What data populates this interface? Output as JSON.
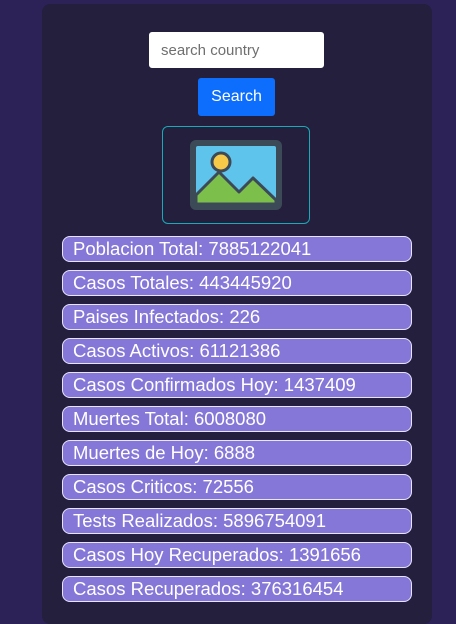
{
  "search": {
    "placeholder": "search country",
    "value": "",
    "button_label": "Search"
  },
  "flag": {
    "icon": "image-placeholder-icon"
  },
  "stats": [
    {
      "label": "Poblacion Total: ",
      "value": "7885122041"
    },
    {
      "label": "Casos Totales: ",
      "value": "443445920"
    },
    {
      "label": "Paises Infectados: ",
      "value": "226"
    },
    {
      "label": "Casos Activos: ",
      "value": "61121386"
    },
    {
      "label": "Casos Confirmados Hoy: ",
      "value": "1437409"
    },
    {
      "label": "Muertes Total: ",
      "value": "6008080"
    },
    {
      "label": "Muertes de Hoy: ",
      "value": "6888"
    },
    {
      "label": "Casos Criticos: ",
      "value": "72556"
    },
    {
      "label": "Tests Realizados: ",
      "value": "5896754091"
    },
    {
      "label": "Casos Hoy Recuperados: ",
      "value": "1391656"
    },
    {
      "label": "Casos Recuperados: ",
      "value": "376316454"
    }
  ],
  "colors": {
    "page_background": "#2d2258",
    "card_background": "#231f3c",
    "button": "#0d6efd",
    "stat_row": "#8577d8",
    "flag_border": "#19a9b8"
  }
}
